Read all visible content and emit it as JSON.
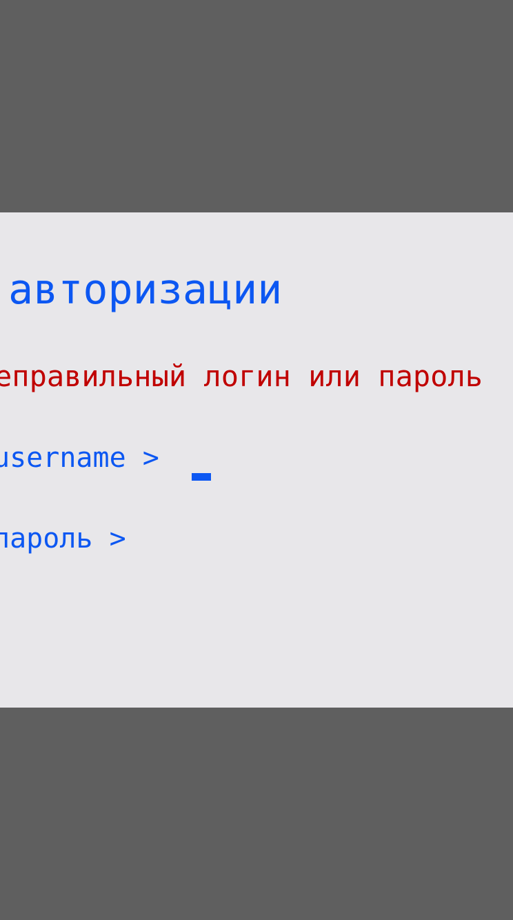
{
  "auth": {
    "title": "авторизации",
    "error": "еправильный логин или пароль",
    "username": {
      "prompt": "username >",
      "value": ""
    },
    "password": {
      "prompt": "пароль >",
      "value": ""
    }
  },
  "colors": {
    "background": "#5f5f5f",
    "panel": "#e8e7ea",
    "accent": "#0c57f2",
    "error": "#c00000"
  }
}
